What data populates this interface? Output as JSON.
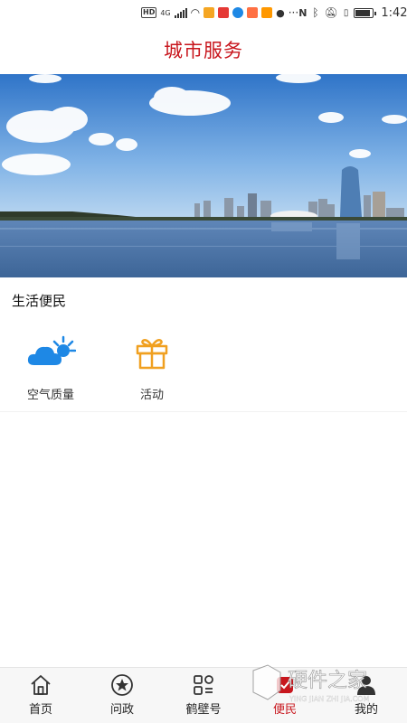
{
  "status_bar": {
    "badge": "HD",
    "network": "4G",
    "time": "1:42",
    "battery_fraction": 0.85
  },
  "header": {
    "title": "城市服务"
  },
  "section": {
    "title": "生活便民"
  },
  "services": [
    {
      "label": "空气质量",
      "icon": "weather-cloud-sun-icon",
      "color": "#1e88e5"
    },
    {
      "label": "活动",
      "icon": "gift-icon",
      "color": "#f0a020"
    }
  ],
  "tabbar": {
    "active_index": 3,
    "accent": "#c8161d",
    "tabs": [
      {
        "label": "首页",
        "icon": "home-icon"
      },
      {
        "label": "问政",
        "icon": "star-circle-icon"
      },
      {
        "label": "鹤壁号",
        "icon": "grid-apps-icon"
      },
      {
        "label": "便民",
        "icon": "service-icon"
      },
      {
        "label": "我的",
        "icon": "user-icon"
      }
    ]
  },
  "watermark": {
    "text": "硬件之家",
    "subtext": "YING JIAN ZHI JIA.COM"
  }
}
